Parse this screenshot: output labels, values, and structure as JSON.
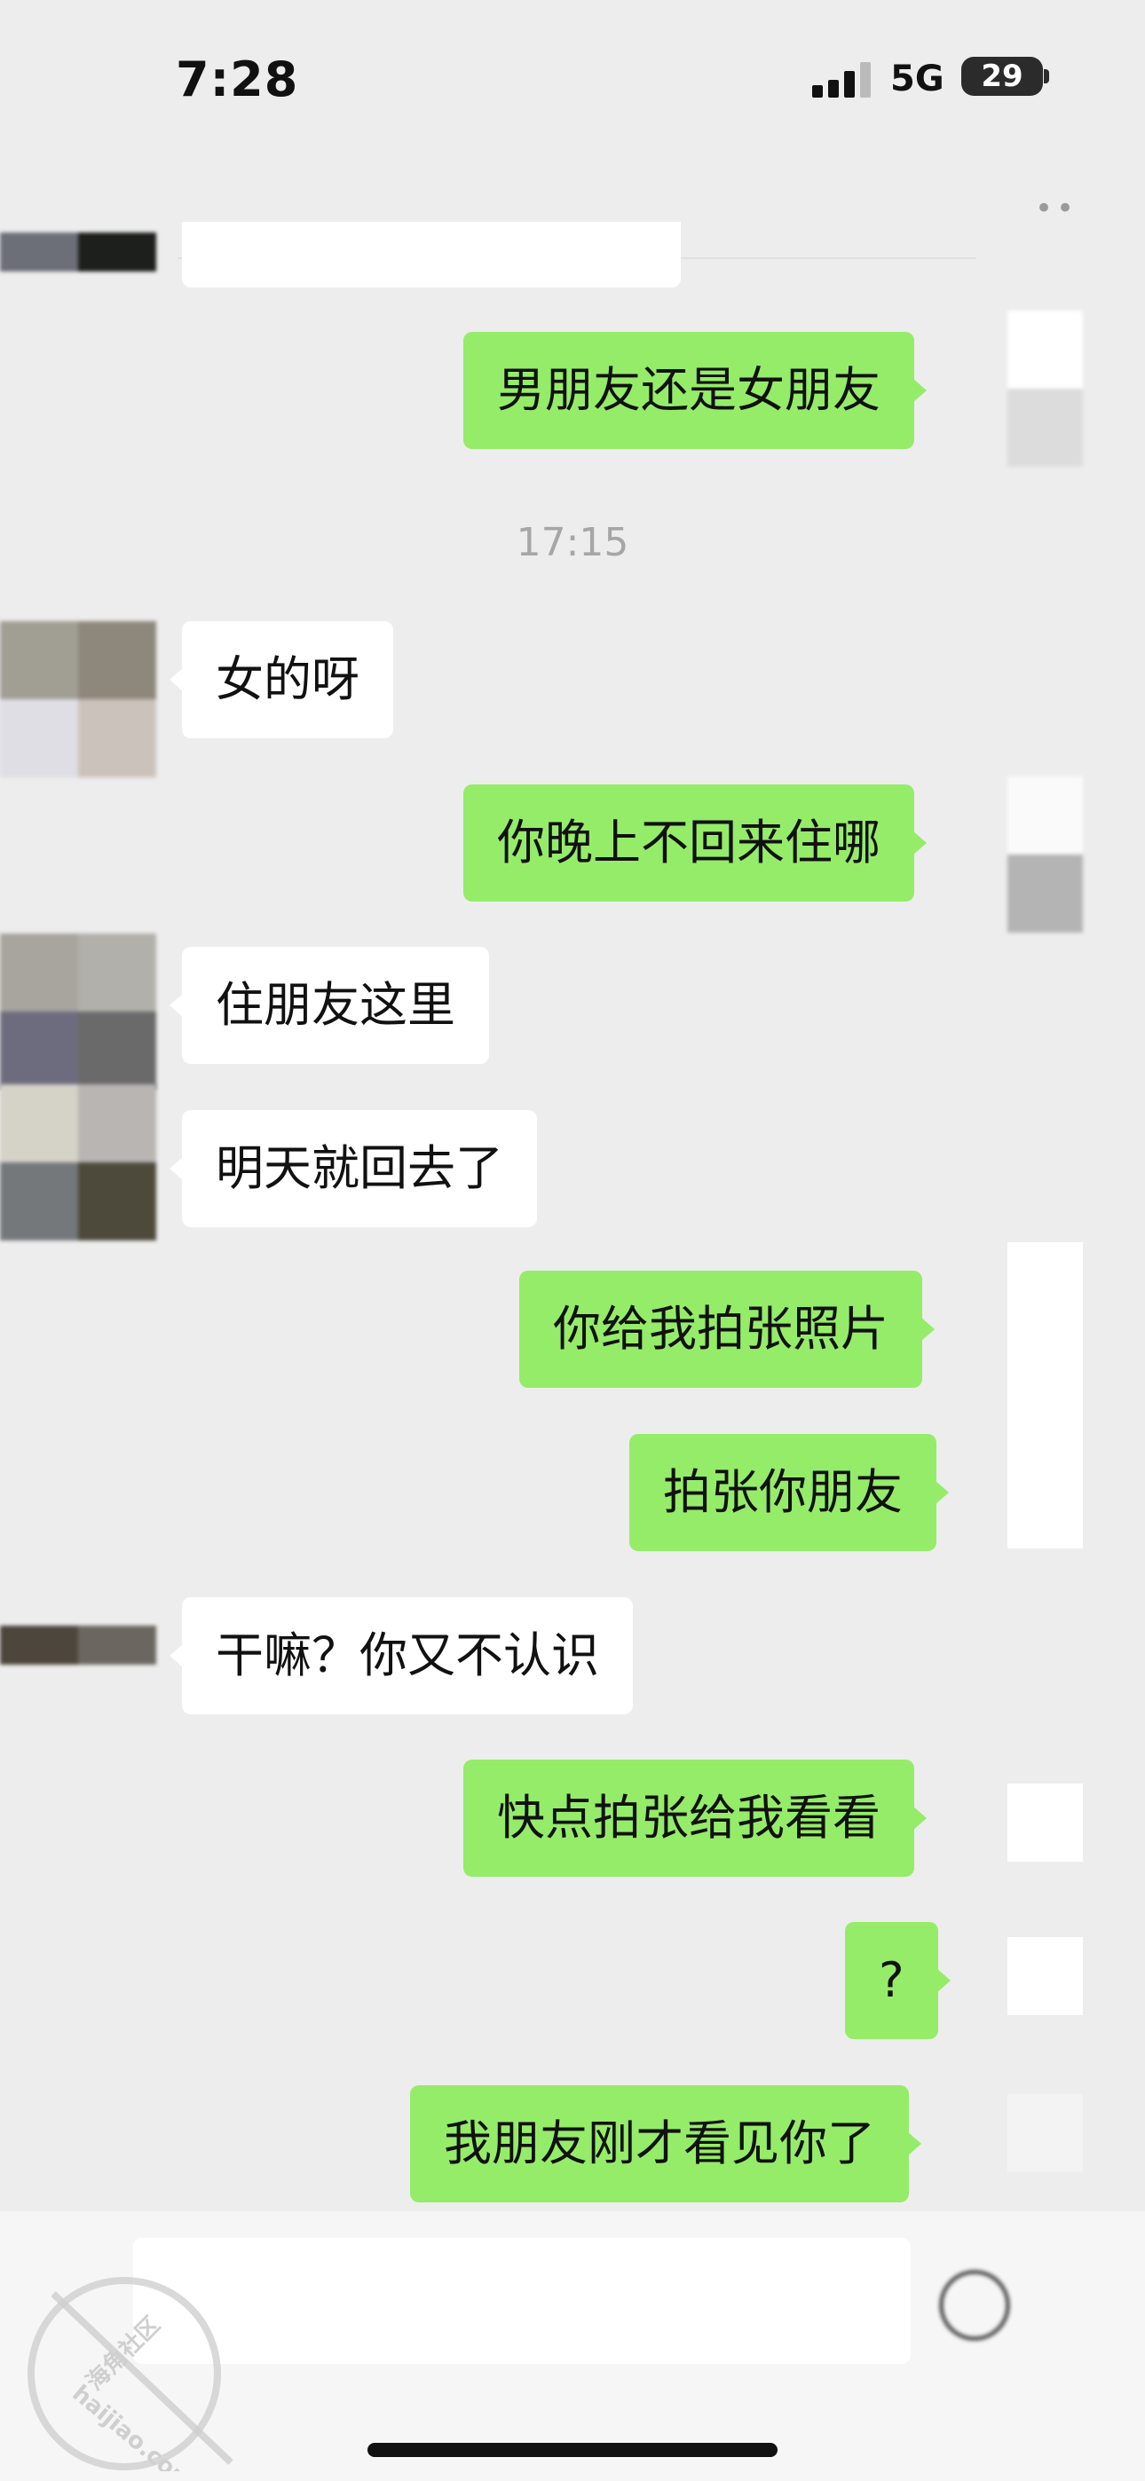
{
  "status_bar": {
    "time": "7:28",
    "network": "5G",
    "battery": "29"
  },
  "chat": {
    "timestamp": "17:15",
    "messages": [
      {
        "side": "out",
        "text": "男朋友还是女朋友"
      },
      {
        "side": "in",
        "text": "女的呀"
      },
      {
        "side": "out",
        "text": "你晚上不回来住哪"
      },
      {
        "side": "in",
        "text": "住朋友这里"
      },
      {
        "side": "in",
        "text": "明天就回去了"
      },
      {
        "side": "out",
        "text": "你给我拍张照片"
      },
      {
        "side": "out",
        "text": "拍张你朋友"
      },
      {
        "side": "in",
        "text": "干嘛？你又不认识"
      },
      {
        "side": "out",
        "text": "快点拍张给我看看"
      },
      {
        "side": "out",
        "text": "?"
      },
      {
        "side": "out",
        "text": "我朋友刚才看见你了"
      }
    ]
  },
  "watermark": {
    "text_cn": "海角社区",
    "text_url": "haijiao.com"
  },
  "colors": {
    "background": "#ededed",
    "incoming_bubble": "#ffffff",
    "outgoing_bubble": "#95ec69",
    "timestamp": "#a6a6a6"
  }
}
